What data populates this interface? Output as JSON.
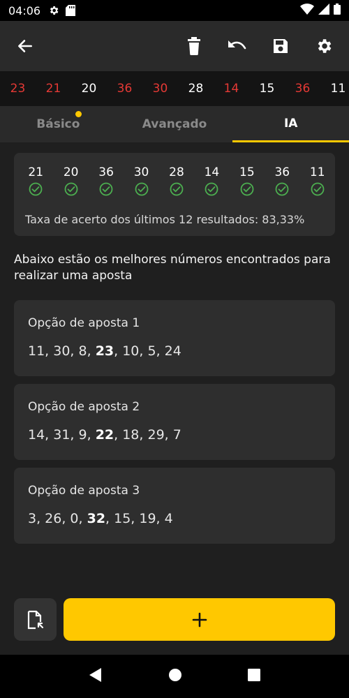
{
  "status_bar": {
    "time": "04:06"
  },
  "recent_numbers": [
    {
      "value": "23",
      "color": "#e53935"
    },
    {
      "value": "21",
      "color": "#e53935"
    },
    {
      "value": "20",
      "color": "#ffffff"
    },
    {
      "value": "36",
      "color": "#e53935"
    },
    {
      "value": "30",
      "color": "#e53935"
    },
    {
      "value": "28",
      "color": "#ffffff"
    },
    {
      "value": "14",
      "color": "#e53935"
    },
    {
      "value": "15",
      "color": "#ffffff"
    },
    {
      "value": "36",
      "color": "#e53935"
    },
    {
      "value": "11",
      "color": "#ffffff"
    }
  ],
  "tabs": [
    {
      "label": "Básico",
      "active": false,
      "dot": true
    },
    {
      "label": "Avançado",
      "active": false,
      "dot": false
    },
    {
      "label": "IA",
      "active": true,
      "dot": false
    }
  ],
  "results": {
    "numbers": [
      "21",
      "20",
      "36",
      "30",
      "28",
      "14",
      "15",
      "36",
      "11"
    ],
    "rate_text": "Taxa de acerto dos últimos 12 resultados: 83,33%"
  },
  "description": "Abaixo estão os melhores números encontrados para realizar uma aposta",
  "options": [
    {
      "title": "Opção de aposta 1",
      "before": "11, 30, 8, ",
      "bold": "23",
      "after": ", 10, 5, 24"
    },
    {
      "title": "Opção de aposta 2",
      "before": "14, 31, 9, ",
      "bold": "22",
      "after": ", 18, 29, 7"
    },
    {
      "title": "Opção de aposta 3",
      "before": "3, 26, 0, ",
      "bold": "32",
      "after": ", 15, 19, 4"
    }
  ],
  "colors": {
    "accent": "#ffc800",
    "red": "#e53935",
    "check": "#4caf50"
  }
}
